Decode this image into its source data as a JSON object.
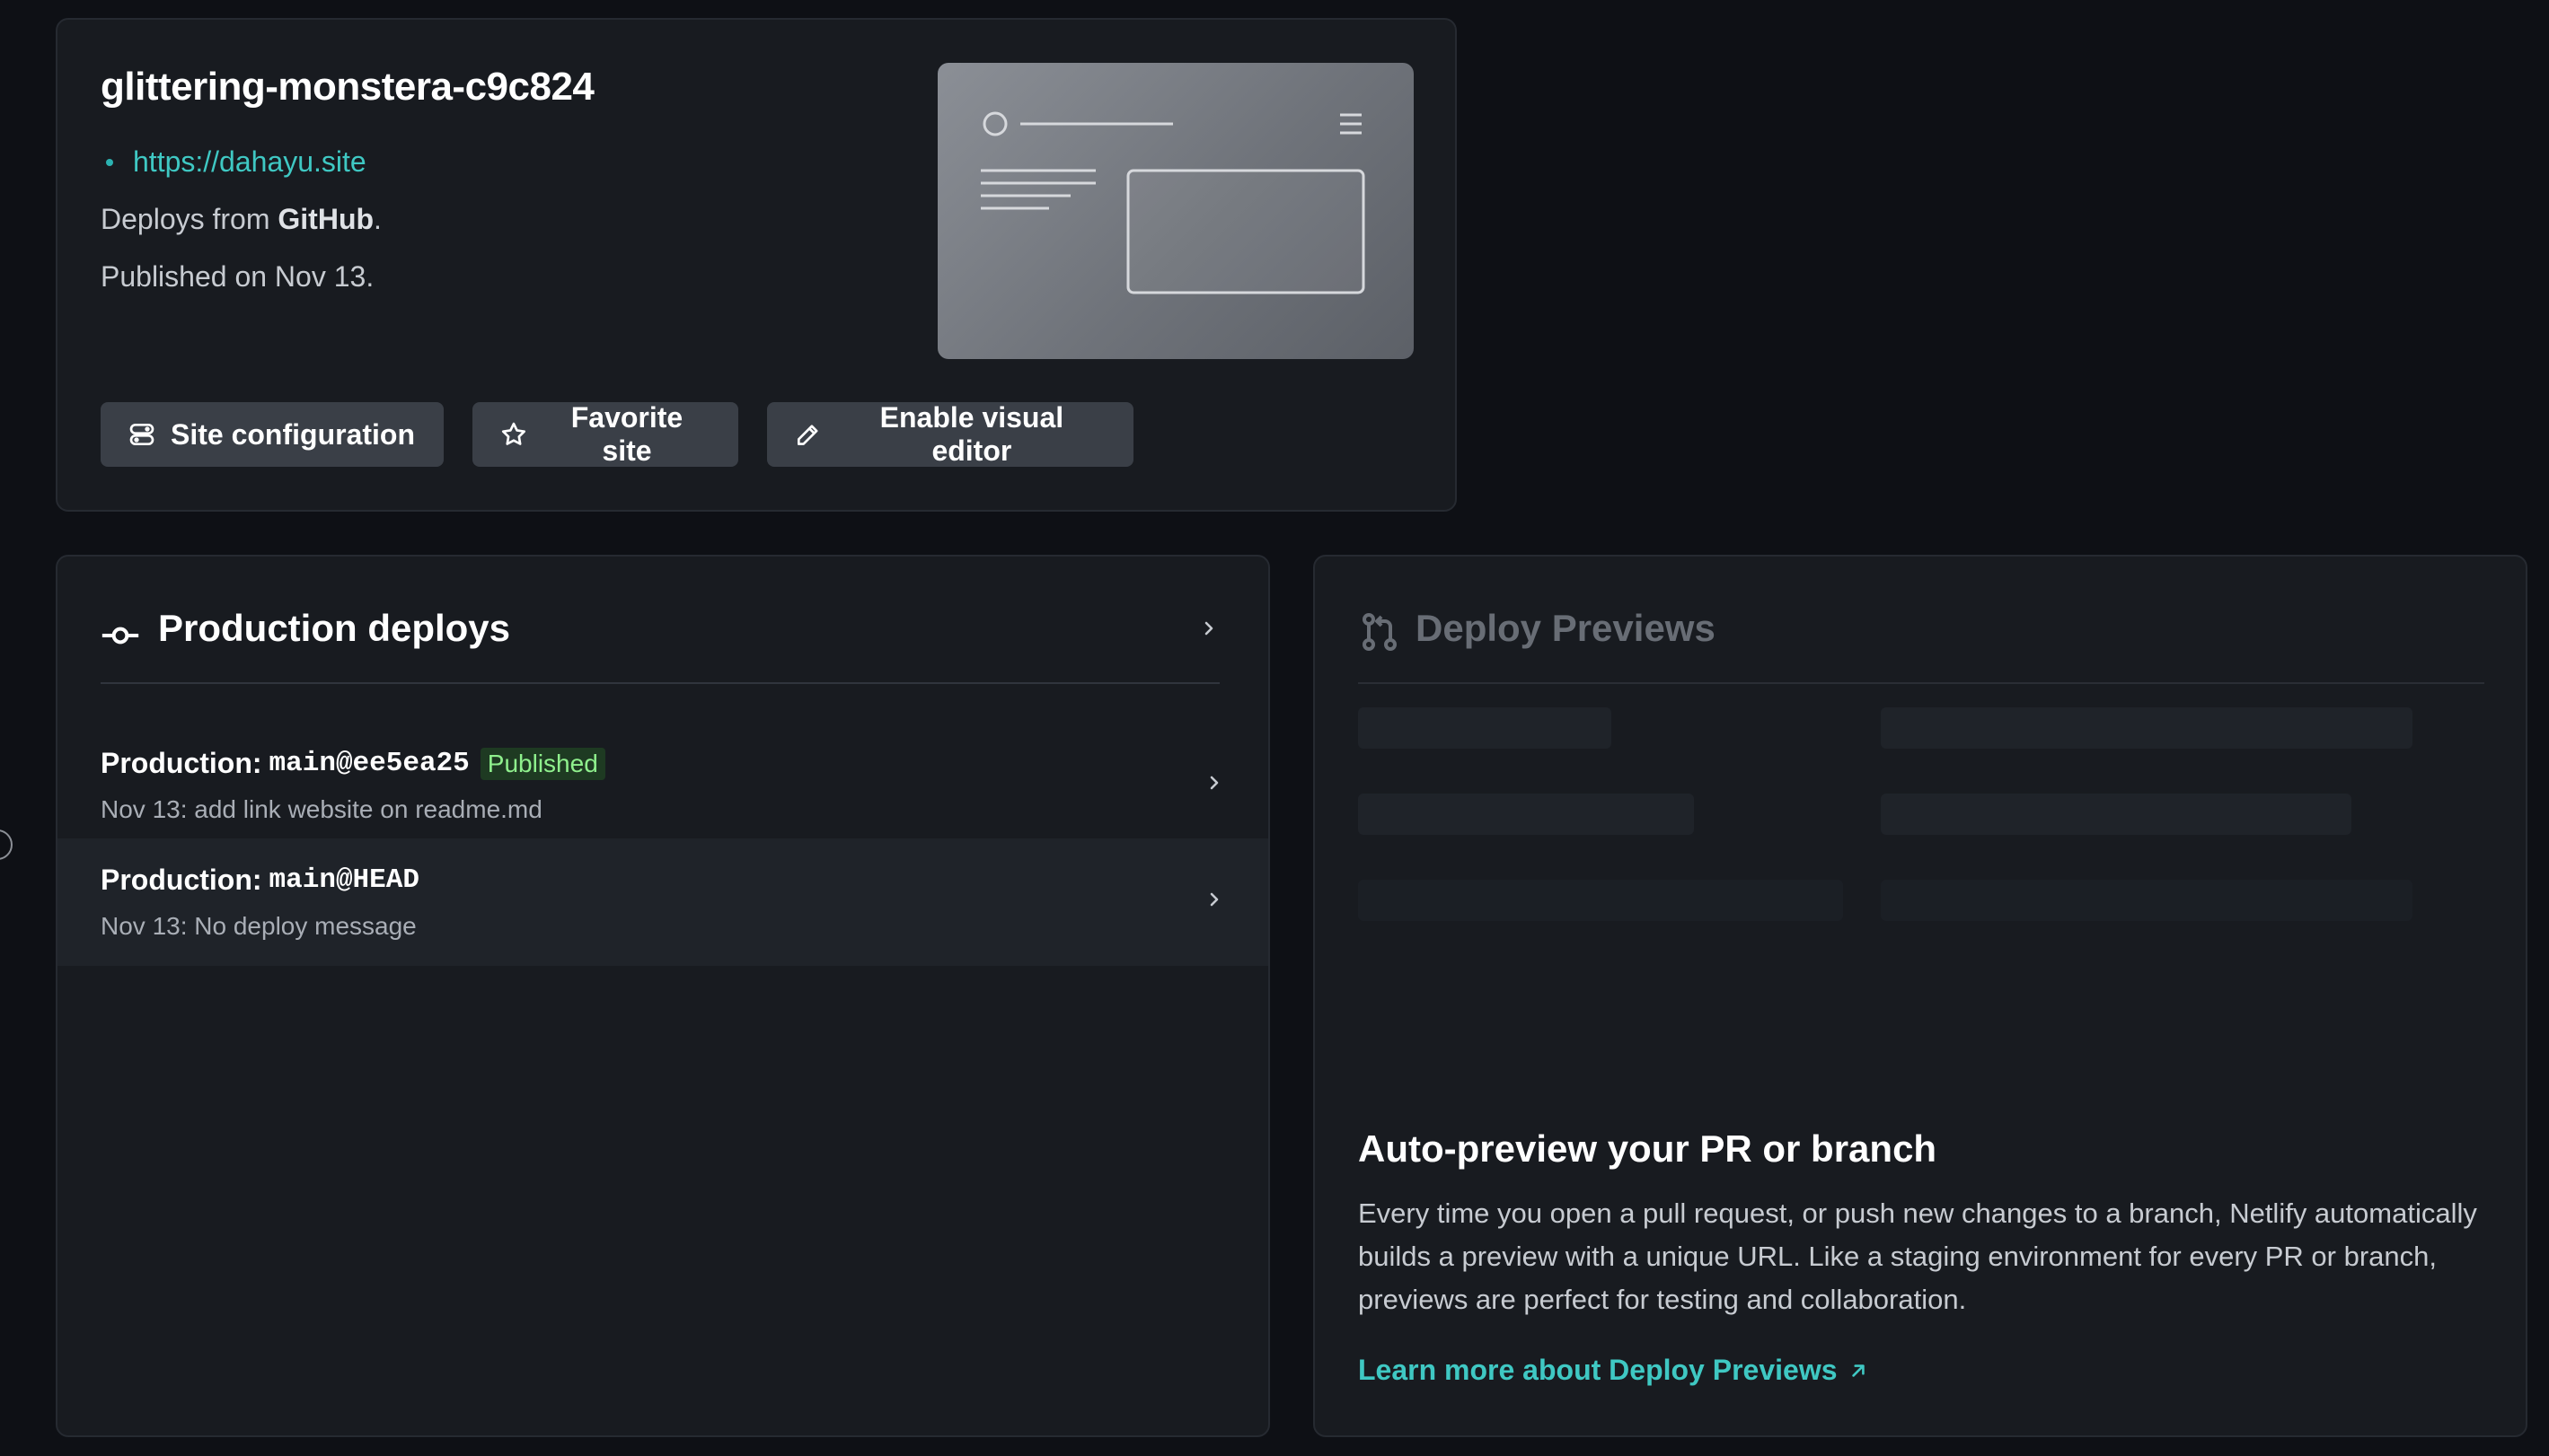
{
  "site": {
    "name": "glittering-monstera-c9c824",
    "url": "https://dahayu.site",
    "deploys_from_prefix": "Deploys from ",
    "deploys_from_provider": "GitHub",
    "deploys_from_suffix": ".",
    "published_on": "Published on Nov 13.",
    "buttons": {
      "config": "Site configuration",
      "favorite": "Favorite site",
      "editor": "Enable visual editor"
    }
  },
  "production": {
    "title": "Production deploys",
    "rows": [
      {
        "prefix": "Production:",
        "ref": "main@ee5ea25",
        "badge": "Published",
        "message": "Nov 13: add link website on readme.md"
      },
      {
        "prefix": "Production:",
        "ref": "main@HEAD",
        "badge": "",
        "message": "Nov 13: No deploy message"
      }
    ]
  },
  "previews": {
    "title": "Deploy Previews",
    "cta_title": "Auto-preview your PR or branch",
    "cta_body": "Every time you open a pull request, or push new changes to a branch, Netlify automatically builds a preview with a unique URL. Like a staging environment for every PR or branch, previews are perfect for testing and collaboration.",
    "learn_more": "Learn more about Deploy Previews"
  },
  "colors": {
    "background": "#0e1015",
    "card": "#181b20",
    "accent_teal": "#3fc8c3",
    "badge_green": "#8ff08d",
    "button": "#3a3f47"
  }
}
